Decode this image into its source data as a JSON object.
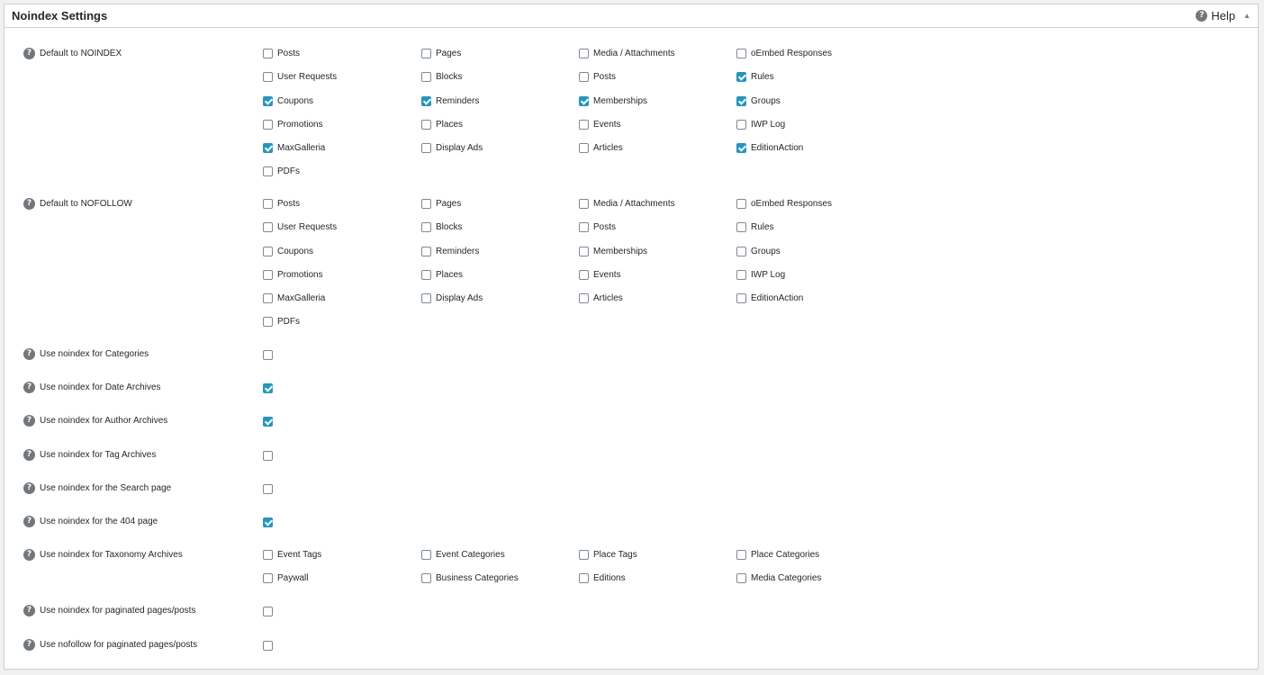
{
  "panel": {
    "title": "Noindex Settings",
    "help_label": "Help",
    "help_icon": "question-circle-icon",
    "toggle_icon": "arrow-up-icon"
  },
  "colors": {
    "accent": "#2596be",
    "border": "#ccd0d4",
    "icon": "#72777c"
  },
  "sections": [
    {
      "label": "Default to NOINDEX",
      "options": [
        {
          "label": "Posts",
          "checked": false
        },
        {
          "label": "Pages",
          "checked": false
        },
        {
          "label": "Media / Attachments",
          "checked": false
        },
        {
          "label": "oEmbed Responses",
          "checked": false
        },
        {
          "label": "User Requests",
          "checked": false
        },
        {
          "label": "Blocks",
          "checked": false
        },
        {
          "label": "Posts",
          "checked": false
        },
        {
          "label": "Rules",
          "checked": true
        },
        {
          "label": "Coupons",
          "checked": true
        },
        {
          "label": "Reminders",
          "checked": true
        },
        {
          "label": "Memberships",
          "checked": true
        },
        {
          "label": "Groups",
          "checked": true
        },
        {
          "label": "Promotions",
          "checked": false
        },
        {
          "label": "Places",
          "checked": false
        },
        {
          "label": "Events",
          "checked": false
        },
        {
          "label": "IWP Log",
          "checked": false
        },
        {
          "label": "MaxGalleria",
          "checked": true
        },
        {
          "label": "Display Ads",
          "checked": false
        },
        {
          "label": "Articles",
          "checked": false
        },
        {
          "label": "EditionAction",
          "checked": true
        },
        {
          "label": "PDFs",
          "checked": false
        }
      ]
    },
    {
      "label": "Default to NOFOLLOW",
      "options": [
        {
          "label": "Posts",
          "checked": false
        },
        {
          "label": "Pages",
          "checked": false
        },
        {
          "label": "Media / Attachments",
          "checked": false
        },
        {
          "label": "oEmbed Responses",
          "checked": false
        },
        {
          "label": "User Requests",
          "checked": false
        },
        {
          "label": "Blocks",
          "checked": false
        },
        {
          "label": "Posts",
          "checked": false
        },
        {
          "label": "Rules",
          "checked": false
        },
        {
          "label": "Coupons",
          "checked": false
        },
        {
          "label": "Reminders",
          "checked": false
        },
        {
          "label": "Memberships",
          "checked": false
        },
        {
          "label": "Groups",
          "checked": false
        },
        {
          "label": "Promotions",
          "checked": false
        },
        {
          "label": "Places",
          "checked": false
        },
        {
          "label": "Events",
          "checked": false
        },
        {
          "label": "IWP Log",
          "checked": false
        },
        {
          "label": "MaxGalleria",
          "checked": false
        },
        {
          "label": "Display Ads",
          "checked": false
        },
        {
          "label": "Articles",
          "checked": false
        },
        {
          "label": "EditionAction",
          "checked": false
        },
        {
          "label": "PDFs",
          "checked": false
        }
      ]
    },
    {
      "label": "Use noindex for Categories",
      "checked": false
    },
    {
      "label": "Use noindex for Date Archives",
      "checked": true
    },
    {
      "label": "Use noindex for Author Archives",
      "checked": true
    },
    {
      "label": "Use noindex for Tag Archives",
      "checked": false
    },
    {
      "label": "Use noindex for the Search page",
      "checked": false
    },
    {
      "label": "Use noindex for the 404 page",
      "checked": true
    },
    {
      "label": "Use noindex for Taxonomy Archives",
      "options": [
        {
          "label": "Event Tags",
          "checked": false
        },
        {
          "label": "Event Categories",
          "checked": false
        },
        {
          "label": "Place Tags",
          "checked": false
        },
        {
          "label": "Place Categories",
          "checked": false
        },
        {
          "label": "Paywall",
          "checked": false
        },
        {
          "label": "Business Categories",
          "checked": false
        },
        {
          "label": "Editions",
          "checked": false
        },
        {
          "label": "Media Categories",
          "checked": false
        }
      ]
    },
    {
      "label": "Use noindex for paginated pages/posts",
      "checked": false
    },
    {
      "label": "Use nofollow for paginated pages/posts",
      "checked": false
    }
  ]
}
